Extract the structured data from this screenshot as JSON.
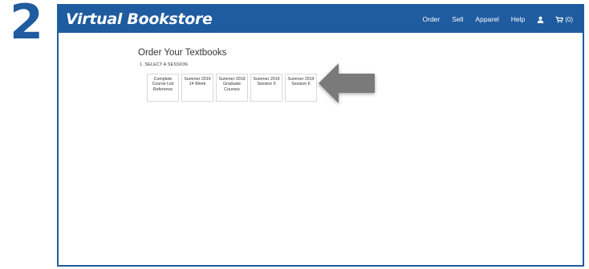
{
  "step_number": "2",
  "header": {
    "brand": "Virtual Bookstore",
    "nav": [
      "Order",
      "Sell",
      "Apparel",
      "Help"
    ],
    "cart_count": "(0)"
  },
  "main": {
    "title": "Order Your Textbooks",
    "step_label": "1. SELECT A SESSION",
    "sessions": [
      {
        "line1": "Complete",
        "line2": "Course List",
        "line3": "Reference"
      },
      {
        "line1": "Summer 2019",
        "line2": "14 Week",
        "line3": ""
      },
      {
        "line1": "Summer 2019",
        "line2": "Graduate",
        "line3": "Courses"
      },
      {
        "line1": "Summer 2019",
        "line2": "Session 5",
        "line3": ""
      },
      {
        "line1": "Summer 2019",
        "line2": "Session 6",
        "line3": ""
      }
    ]
  },
  "icons": {
    "user": "user-icon",
    "cart": "cart-icon",
    "pointer": "arrow-left-icon"
  },
  "colors": {
    "brand_blue": "#1f5b9f",
    "arrow_gray": "#7a7a7a"
  }
}
